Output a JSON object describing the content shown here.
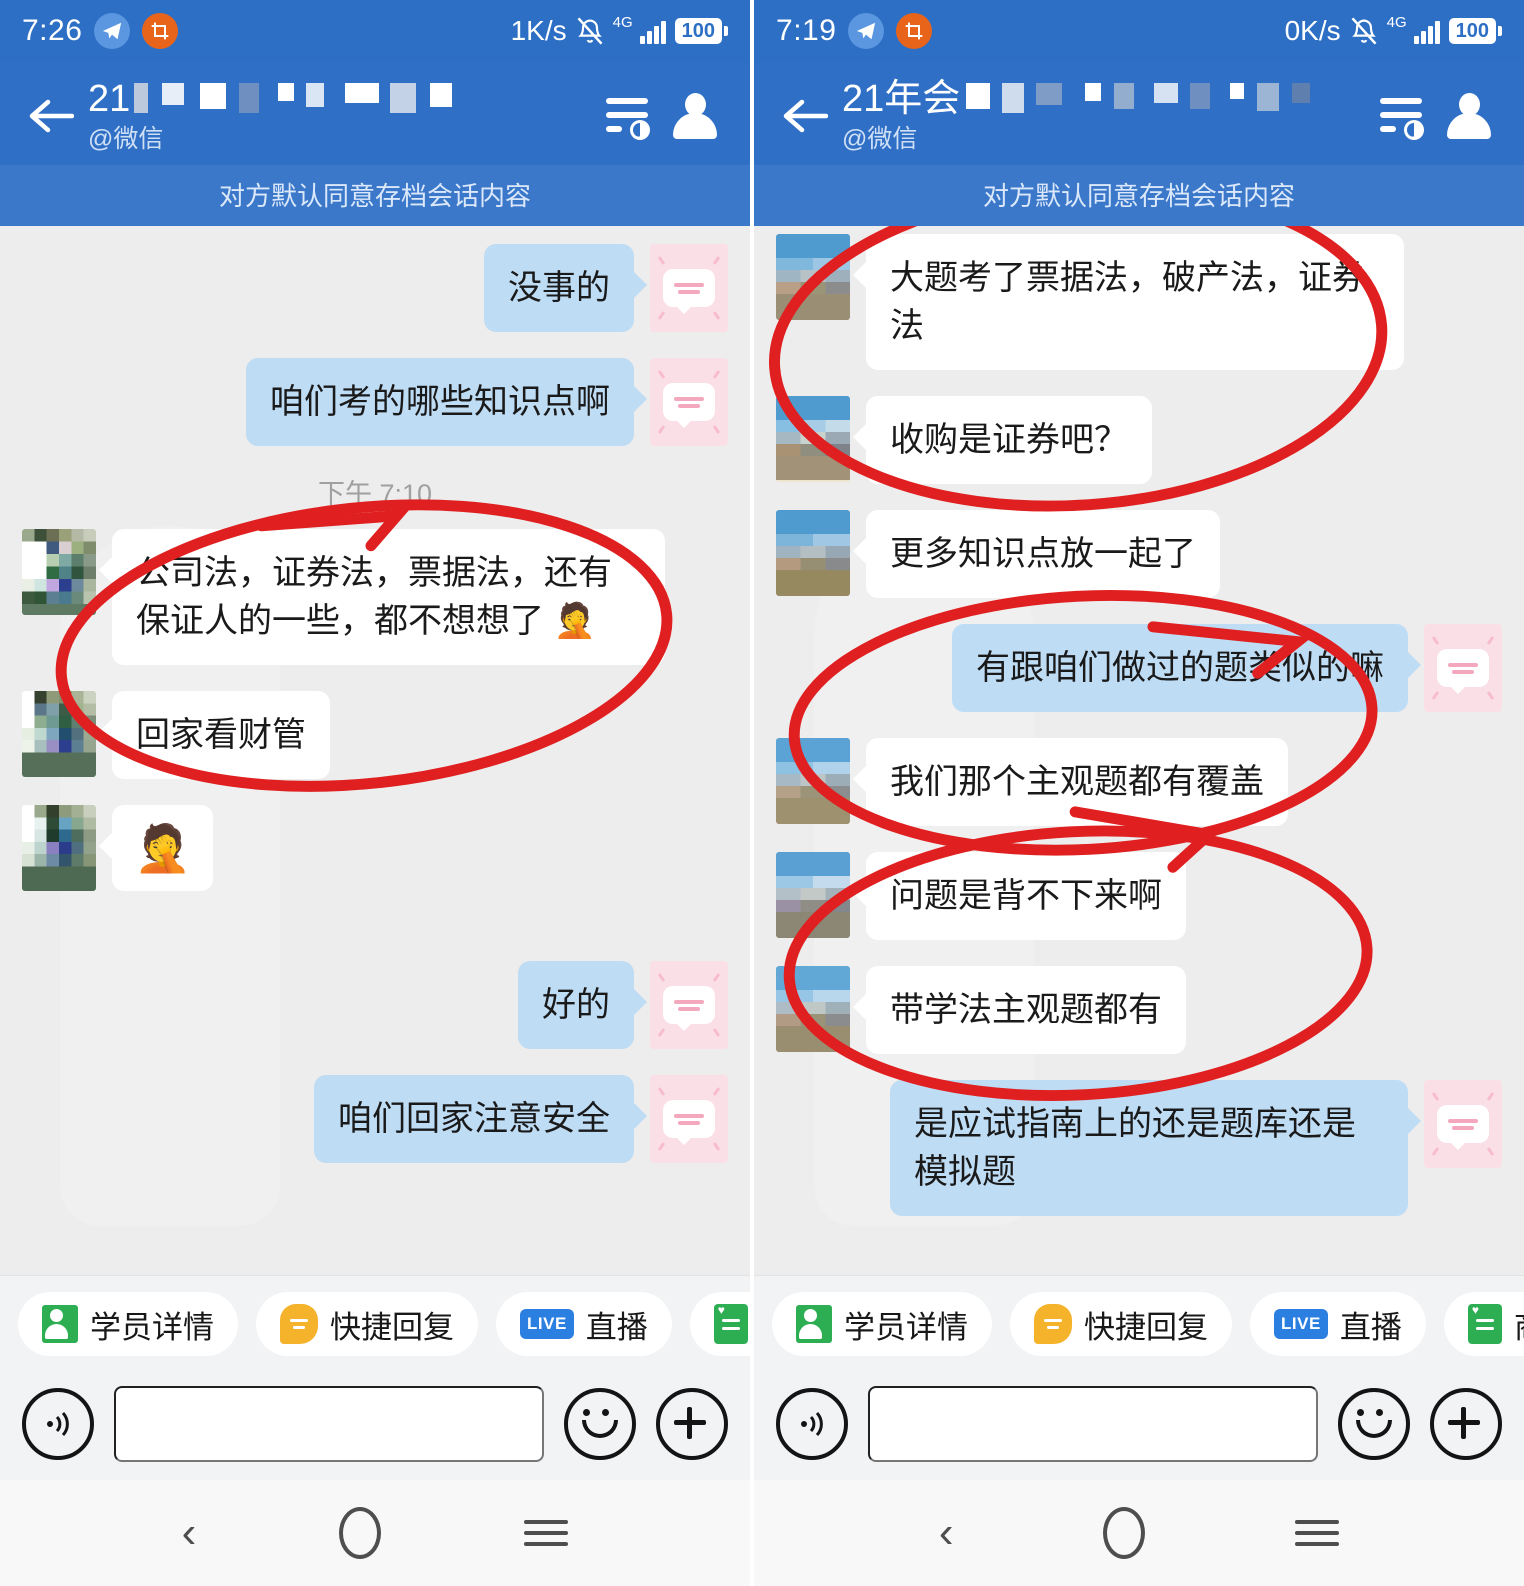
{
  "left": {
    "status": {
      "time": "7:26",
      "net_speed": "1K/s",
      "battery": "100",
      "network": "4G"
    },
    "header": {
      "title_prefix": "21",
      "subtitle": "@微信"
    },
    "notice": "对方默认同意存档会话内容",
    "timestamp": "下午 7:10",
    "messages": [
      {
        "side": "out",
        "text": "没事的"
      },
      {
        "side": "out",
        "text": "咱们考的哪些知识点啊"
      },
      {
        "side": "in",
        "text": "公司法，证券法，票据法，还有保证人的一些，都不想想了 🤦"
      },
      {
        "side": "in",
        "text": "回家看财管"
      },
      {
        "side": "in",
        "text": "🤦"
      },
      {
        "side": "out",
        "text": "好的"
      },
      {
        "side": "out",
        "text": "咱们回家注意安全"
      }
    ]
  },
  "right": {
    "status": {
      "time": "7:19",
      "net_speed": "0K/s",
      "battery": "100",
      "network": "4G"
    },
    "header": {
      "title_prefix": "21年会",
      "subtitle": "@微信"
    },
    "notice": "对方默认同意存档会话内容",
    "messages": [
      {
        "side": "in",
        "text": "大题考了票据法，破产法，证券法"
      },
      {
        "side": "in",
        "text": "收购是证券吧？"
      },
      {
        "side": "in",
        "text": "更多知识点放一起了"
      },
      {
        "side": "out",
        "text": "有跟咱们做过的题类似的嘛"
      },
      {
        "side": "in",
        "text": "我们那个主观题都有覆盖"
      },
      {
        "side": "in",
        "text": "问题是背不下来啊"
      },
      {
        "side": "in",
        "text": "带学法主观题都有"
      },
      {
        "side": "out",
        "text": "是应试指南上的还是题库还是模拟题"
      }
    ]
  },
  "quick_actions": [
    {
      "label": "学员详情",
      "icon": "person-card-icon"
    },
    {
      "label": "快捷回复",
      "icon": "quick-reply-icon"
    },
    {
      "label": "直播",
      "icon": "live-icon",
      "badge": "LIVE"
    },
    {
      "label": "商品图册",
      "icon": "product-catalog-icon"
    }
  ],
  "input": {
    "value": "",
    "placeholder": ""
  },
  "colors": {
    "header_blue": "#2f6fc6",
    "status_blue": "#2d6fc4",
    "notice_blue": "#3b78ca",
    "chat_bg": "#ededed",
    "out_bubble": "#bfdcf5",
    "in_bubble": "#ffffff",
    "annotation_red": "#e02020",
    "accent_green": "#2eae52",
    "accent_yellow": "#f5b32b"
  }
}
